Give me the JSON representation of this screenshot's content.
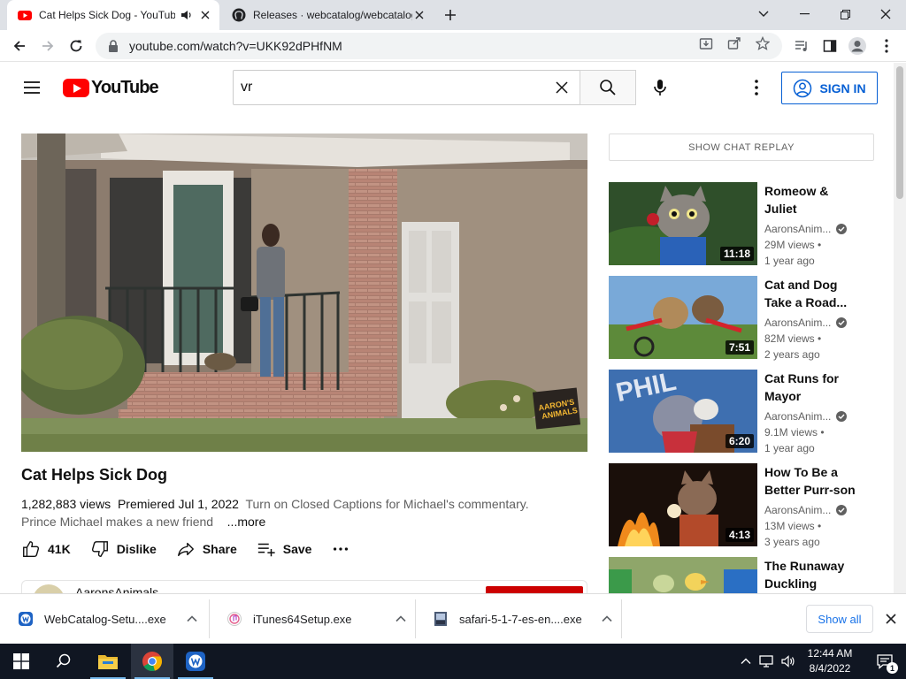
{
  "browser": {
    "tabs": [
      {
        "title": "Cat Helps Sick Dog - YouTube",
        "active": true
      },
      {
        "title": "Releases · webcatalog/webcatalog",
        "active": false
      }
    ],
    "url": "youtube.com/watch?v=UKK92dPHfNM"
  },
  "youtube": {
    "logo_text": "YouTube",
    "search_query": "vr",
    "sign_in_label": "SIGN IN"
  },
  "video": {
    "title": "Cat Helps Sick Dog",
    "views": "1,282,883 views",
    "premiered": "Premiered Jul 1, 2022",
    "description_line1": "Turn on Closed Captions for Michael's commentary.",
    "description_line2": "Prince Michael makes a new friend",
    "more_label": "...more",
    "likes": "41K",
    "dislike_label": "Dislike",
    "share_label": "Share",
    "save_label": "Save",
    "channel_name": "AaronsAnimals",
    "watermark": "AARON'S ANIMALS"
  },
  "sidebar": {
    "chat_replay_label": "SHOW CHAT REPLAY",
    "recommendations": [
      {
        "title": "Romeow & Juliet",
        "channel": "AaronsAnim...",
        "views": "29M views •",
        "age": "1 year ago",
        "duration": "11:18"
      },
      {
        "title": "Cat and Dog Take a Road...",
        "channel": "AaronsAnim...",
        "views": "82M views •",
        "age": "2 years ago",
        "duration": "7:51"
      },
      {
        "title": "Cat Runs for Mayor",
        "channel": "AaronsAnim...",
        "views": "9.1M views •",
        "age": "1 year ago",
        "duration": "6:20"
      },
      {
        "title": "How To Be a Better Purr-son",
        "channel": "AaronsAnim...",
        "views": "13M views •",
        "age": "3 years ago",
        "duration": "4:13"
      },
      {
        "title": "The Runaway Duckling",
        "channel": "",
        "views": "",
        "age": "",
        "duration": ""
      }
    ]
  },
  "downloads": {
    "items": [
      {
        "name": "WebCatalog-Setu....exe"
      },
      {
        "name": "iTunes64Setup.exe"
      },
      {
        "name": "safari-5-1-7-es-en....exe"
      }
    ],
    "show_all_label": "Show all"
  },
  "taskbar": {
    "time": "12:44 AM",
    "date": "8/4/2022",
    "notification_count": "1"
  },
  "colors": {
    "youtube_red": "#ff0000",
    "link_blue": "#065fd4",
    "taskbar_bg": "#101622"
  }
}
